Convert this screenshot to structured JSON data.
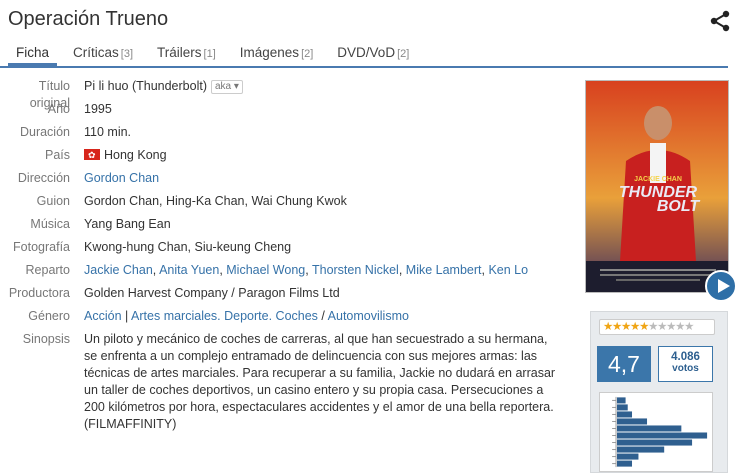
{
  "title": "Operación Trueno",
  "tabs": [
    {
      "label": "Ficha",
      "count": ""
    },
    {
      "label": "Críticas",
      "count": "[3]"
    },
    {
      "label": "Tráilers",
      "count": "[1]"
    },
    {
      "label": "Imágenes",
      "count": "[2]"
    },
    {
      "label": "DVD/VoD",
      "count": "[2]"
    }
  ],
  "info": {
    "titulo_original": {
      "label": "Título original",
      "value": "Pi li huo (Thunderbolt)",
      "aka": "aka"
    },
    "ano": {
      "label": "Año",
      "value": "1995"
    },
    "duracion": {
      "label": "Duración",
      "value": "110 min."
    },
    "pais": {
      "label": "País",
      "value": "Hong Kong"
    },
    "direccion": {
      "label": "Dirección",
      "value": "Gordon Chan"
    },
    "guion": {
      "label": "Guion",
      "value": "Gordon Chan, Hing-Ka Chan, Wai Chung Kwok"
    },
    "musica": {
      "label": "Música",
      "value": "Yang Bang Ean"
    },
    "fotografia": {
      "label": "Fotografía",
      "value": "Kwong-hung Chan, Siu-keung Cheng"
    },
    "reparto": {
      "label": "Reparto",
      "actors": [
        "Jackie Chan",
        "Anita Yuen",
        "Michael Wong",
        "Thorsten Nickel",
        "Mike Lambert",
        "Ken Lo"
      ]
    },
    "productora": {
      "label": "Productora",
      "value": "Golden Harvest Company / Paragon Films Ltd"
    },
    "genero": {
      "label": "Género",
      "items": [
        "Acción",
        "Artes marciales. Deporte. Coches",
        "Automovilismo"
      ]
    },
    "sinopsis": {
      "label": "Sinopsis",
      "value": "Un piloto y mecánico de coches de carreras, al que han secuestrado a su hermana, se enfrenta a un complejo entramado de delincuencia con sus mejores armas: las técnicas de artes marciales. Para recuperar a su familia, Jackie no dudará en arrasar un taller de coches deportivos, un casino entero y su propia casa. Persecuciones a 200 kilómetros por hora, espectaculares accidentes y el amor de una bella reportera. (FILMAFFINITY)"
    }
  },
  "poster": {
    "star": "JACKIE CHAN",
    "title_line1": "THUNDER",
    "title_line2": "BOLT"
  },
  "rating": {
    "average": "4,7",
    "stars_filled": 5,
    "stars_total": 10,
    "votes_count": "4.086",
    "votes_label": "votos",
    "histogram": [
      {
        "score": 10,
        "share": 0.04
      },
      {
        "score": 9,
        "share": 0.05
      },
      {
        "score": 8,
        "share": 0.07
      },
      {
        "score": 7,
        "share": 0.14
      },
      {
        "score": 6,
        "share": 0.3
      },
      {
        "score": 5,
        "share": 0.42
      },
      {
        "score": 4,
        "share": 0.35
      },
      {
        "score": 3,
        "share": 0.22
      },
      {
        "score": 2,
        "share": 0.1
      },
      {
        "score": 1,
        "share": 0.07
      }
    ]
  },
  "colors": {
    "accent": "#4a7ab0",
    "link": "#3672a8",
    "star": "#f0a515",
    "rating_bg": "#3b76aa"
  }
}
